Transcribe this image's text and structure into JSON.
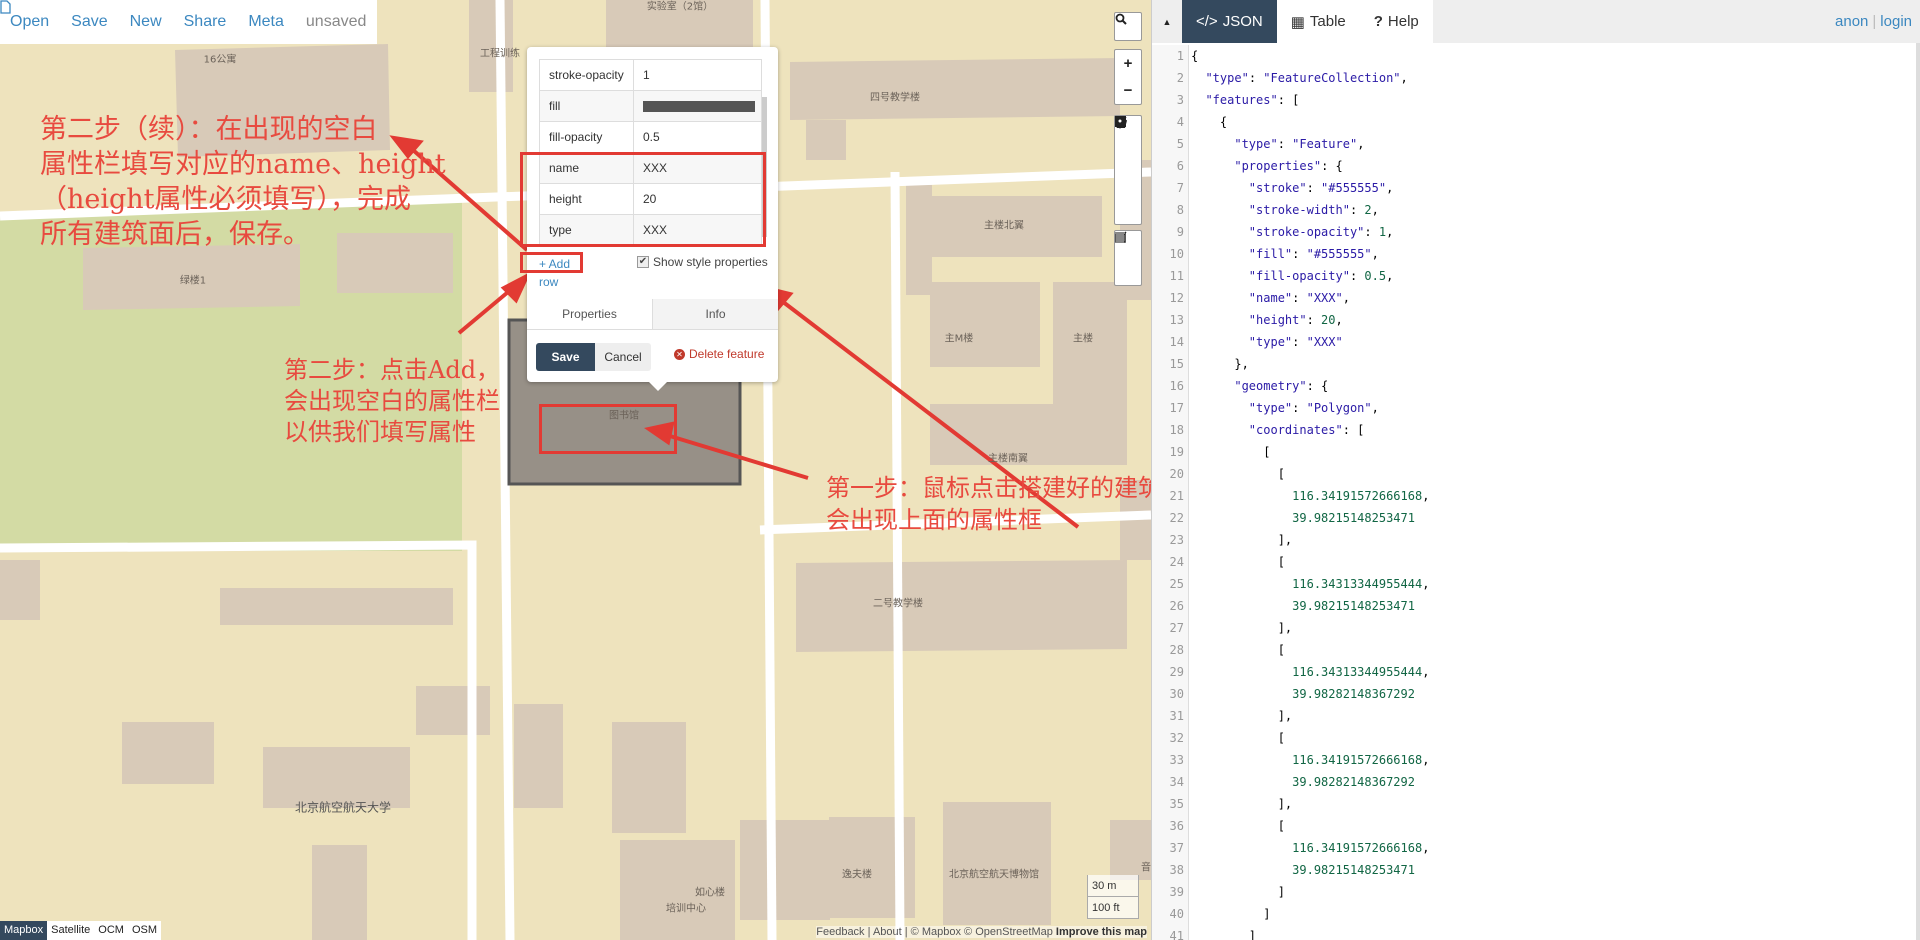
{
  "toolbar": {
    "open": "Open",
    "save": "Save",
    "new": "New",
    "share": "Share",
    "meta": "Meta",
    "file_status": "unsaved"
  },
  "map": {
    "labels": [
      "16公寓",
      "工程训练",
      "实验室（2馆）",
      "四号教学楼",
      "主楼北翼",
      "绿楼1",
      "主M楼",
      "主楼",
      "主楼南翼",
      "图书馆",
      "二号教学楼",
      "北京航空航天大学",
      "逸夫楼",
      "北京航空航天博物馆",
      "培训中心",
      "如心楼",
      "音"
    ],
    "controls": {
      "search": "search-icon",
      "zoom_in": "+",
      "zoom_out": "−"
    },
    "scale": {
      "metric": "30 m",
      "imperial": "100 ft"
    },
    "layers": [
      "Mapbox",
      "Satellite",
      "OCM",
      "OSM"
    ],
    "active_layer": "Mapbox",
    "attribution": {
      "feedback": "Feedback",
      "about": "About",
      "mapbox": "© Mapbox",
      "osm": "© OpenStreetMap",
      "improve": "Improve this map"
    },
    "colors": {
      "land": "#eee3bd",
      "building": "#d8cab8",
      "park": "#d3dba4",
      "selected_fill": "#555555",
      "accent": "#34495e"
    }
  },
  "annotations": {
    "step2_cont": [
      "第二步（续）：在出现的空白",
      "属性栏填写对应的name、height",
      "（height属性必须填写），完成",
      "所有建筑面后，保存。"
    ],
    "step2": [
      "第二步：点击Add，",
      "会出现空白的属性栏",
      "以供我们填写属性"
    ],
    "step1": [
      "第一步：鼠标点击搭建好的建筑面，",
      "会出现上面的属性框"
    ],
    "color": "#e84a3f"
  },
  "popup": {
    "rows": [
      {
        "key": "stroke-opacity",
        "value": "1"
      },
      {
        "key": "fill",
        "value": "",
        "swatch": "#555555"
      },
      {
        "key": "fill-opacity",
        "value": "0.5"
      },
      {
        "key": "name",
        "value": "XXX"
      },
      {
        "key": "height",
        "value": "20"
      },
      {
        "key": "type",
        "value": "XXX"
      }
    ],
    "add_row": "+ Add row",
    "show_style": "Show style properties",
    "show_style_checked": true,
    "tabs": [
      "Properties",
      "Info"
    ],
    "save": "Save",
    "cancel": "Cancel",
    "delete": "Delete feature"
  },
  "panel": {
    "tabs": [
      {
        "icon": "</>",
        "label": "JSON"
      },
      {
        "icon": "▦",
        "label": "Table"
      },
      {
        "icon": "?",
        "label": "Help"
      }
    ],
    "active_tab": "JSON",
    "user": "anon",
    "login": "login",
    "lines": [
      "{",
      "  \"type\": \"FeatureCollection\",",
      "  \"features\": [",
      "    {",
      "      \"type\": \"Feature\",",
      "      \"properties\": {",
      "        \"stroke\": \"#555555\",",
      "        \"stroke-width\": 2,",
      "        \"stroke-opacity\": 1,",
      "        \"fill\": \"#555555\",",
      "        \"fill-opacity\": 0.5,",
      "        \"name\": \"XXX\",",
      "        \"height\": 20,",
      "        \"type\": \"XXX\"",
      "      },",
      "      \"geometry\": {",
      "        \"type\": \"Polygon\",",
      "        \"coordinates\": [",
      "          [",
      "            [",
      "              116.34191572666168,",
      "              39.98215148253471",
      "            ],",
      "            [",
      "              116.34313344955444,",
      "              39.98215148253471",
      "            ],",
      "            [",
      "              116.34313344955444,",
      "              39.98282148367292",
      "            ],",
      "            [",
      "              116.34191572666168,",
      "              39.98282148367292",
      "            ],",
      "            [",
      "              116.34191572666168,",
      "              39.98215148253471",
      "            ]",
      "          ]",
      "        ]"
    ]
  }
}
